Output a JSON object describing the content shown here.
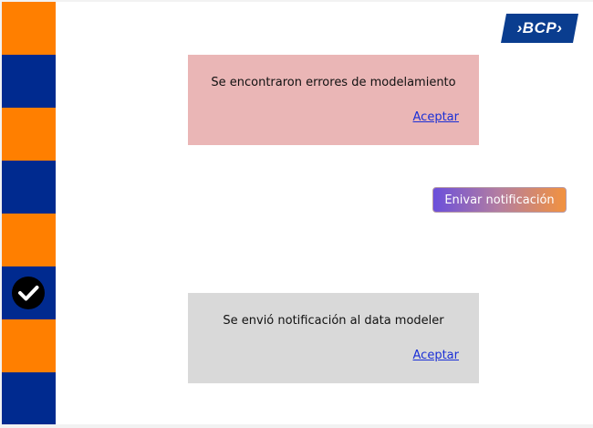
{
  "brand": {
    "logo_text": "›BCP›"
  },
  "sidebar": {
    "segments": [
      "orange",
      "blue",
      "orange",
      "blue",
      "orange",
      "blue-check",
      "orange",
      "blue"
    ],
    "colors": {
      "orange": "#ff7f00",
      "blue": "#002a8f"
    },
    "active_step_icon": "check-circle-icon"
  },
  "error_dialog": {
    "message": "Se encontraron errores de modelamiento",
    "action_label": "Aceptar",
    "color": "#eab6b6"
  },
  "notify_button": {
    "label": "Enivar notificación"
  },
  "info_dialog": {
    "message": "Se envió notificación al data modeler",
    "action_label": "Aceptar",
    "color": "#d9d9d9"
  }
}
